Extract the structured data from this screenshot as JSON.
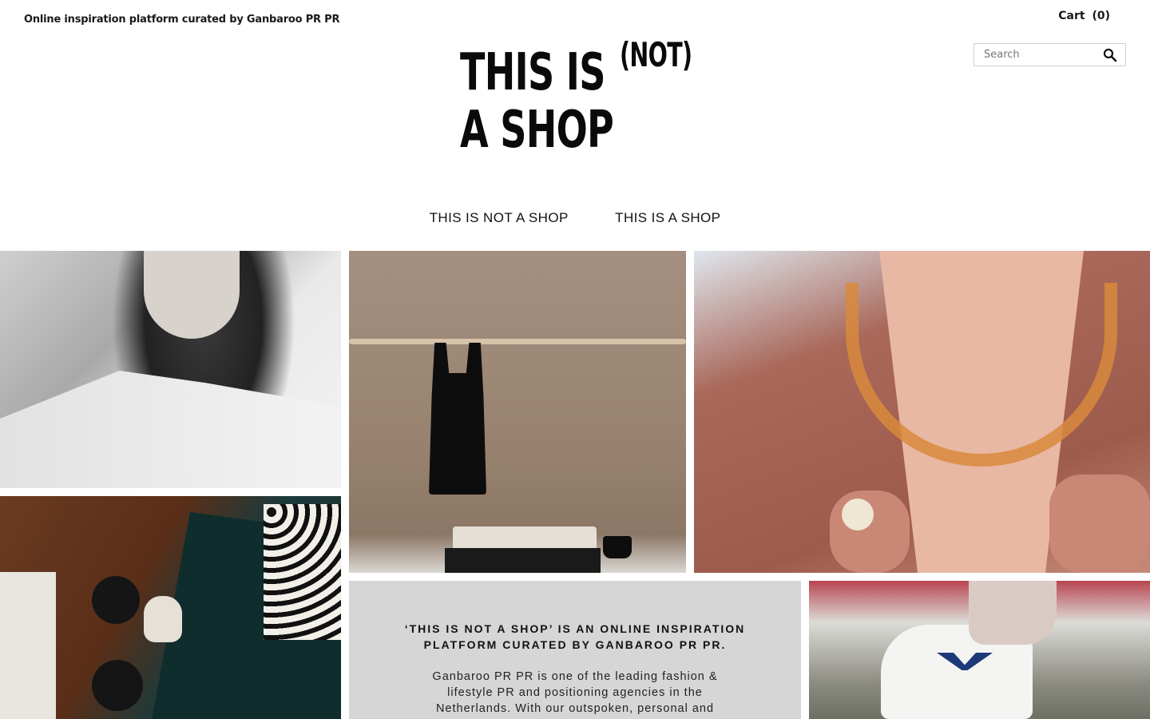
{
  "header": {
    "tagline": "Online inspiration platform curated by Ganbaroo PR PR",
    "cart_label": "Cart",
    "cart_count": "(0)",
    "search_placeholder": "Search",
    "search_icon": "search-icon"
  },
  "logo": {
    "line1": "THIS IS",
    "superscript": "(NOT)",
    "line2": "A SHOP"
  },
  "nav": {
    "items": [
      {
        "label": "THIS IS NOT A SHOP"
      },
      {
        "label": "THIS IS A SHOP"
      }
    ]
  },
  "tiles": {
    "about_heading": "‘THIS IS NOT A SHOP’ IS AN ONLINE INSPIRATION PLATFORM CURATED BY GANBAROO PR PR.",
    "about_body": "Ganbaroo PR PR is one of the leading fashion & lifestyle PR and positioning agencies in the Netherlands. With our outspoken, personal and"
  }
}
